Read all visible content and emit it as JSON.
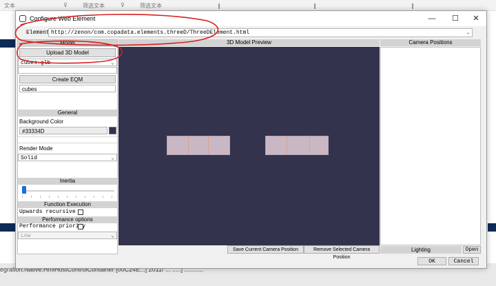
{
  "background_app": {
    "top_bar": {
      "label_1": "文本",
      "label_2": "筛选文本",
      "label_3": "筛选文本"
    },
    "footer_text": "egration.Native.HmiHostControlContainer [00C24E...] 2011/ ... .....] ...........",
    "colors": {
      "strip": "#0d2b56"
    }
  },
  "dialog": {
    "title": "Configure Web Element",
    "window_buttons": {
      "minimize": "—",
      "maximize": "☐",
      "close": "✕"
    },
    "element_label": "Element:",
    "element_value": "http://zenon/com.copadata.elements.threeD/ThreeDElement.html",
    "left_panel": {
      "model_header": "Model",
      "upload_button": "Upload 3D Model",
      "model_select_value": "cubes.glb",
      "create_eqm_button": "Create EQM",
      "eqm_name_value": "cubes",
      "general_header": "General",
      "background_color_label": "Background Color",
      "background_color_value": "#33334D",
      "render_mode_label": "Render Mode",
      "render_mode_value": "Solid",
      "inertia_header": "Inertia",
      "inertia_level": 0.02,
      "function_header": "Function Execution",
      "upwards_recursive_label": "Upwards recursive",
      "upwards_recursive_checked": false,
      "performance_header": "Performance options",
      "performance_priority_label": "Performance priority",
      "performance_priority_checked": false,
      "priority_select_value": "Low"
    },
    "preview": {
      "header": "3D Model Preview",
      "background": "#33334D",
      "cube_color": "#c9b8c4",
      "save_button": "Save Current Camera Position",
      "remove_button": "Remove Selected Camera Position"
    },
    "camera_panel": {
      "header": "Camera Positions",
      "lighting_label": "Lighting",
      "open_button": "Open"
    },
    "ok_button": "OK",
    "cancel_button": "Cancel"
  },
  "annotation_color": "#d42020"
}
